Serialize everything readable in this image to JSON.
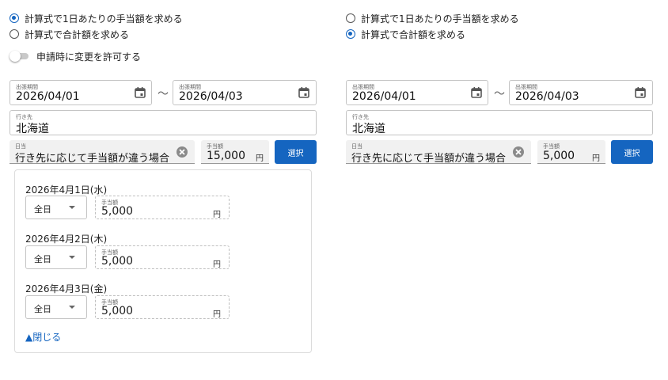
{
  "left": {
    "radio_daily": {
      "label": "計算式で1日あたりの手当額を求める",
      "checked": true
    },
    "radio_total": {
      "label": "計算式で合計額を求める",
      "checked": false
    },
    "toggle": {
      "label": "申請時に変更を許可する",
      "on": false
    },
    "period": {
      "label": "出張期間",
      "start": "2026/04/01",
      "tilde": "〜",
      "end": "2026/04/03"
    },
    "destination": {
      "label": "行き先",
      "value": "北海道"
    },
    "allowance_type": {
      "label": "日当",
      "value": "行き先に応じて手当額が違う場合"
    },
    "amount": {
      "label": "手当額",
      "value": "15,000",
      "unit": "円"
    },
    "select_button": "選択",
    "days": [
      {
        "date": "2026年4月1日(水)",
        "option": "全日",
        "amount_label": "手当額",
        "amount": "5,000",
        "unit": "円"
      },
      {
        "date": "2026年4月2日(木)",
        "option": "全日",
        "amount_label": "手当額",
        "amount": "5,000",
        "unit": "円"
      },
      {
        "date": "2026年4月3日(金)",
        "option": "全日",
        "amount_label": "手当額",
        "amount": "5,000",
        "unit": "円"
      }
    ],
    "close_link": "▲閉じる"
  },
  "right": {
    "radio_daily": {
      "label": "計算式で1日あたりの手当額を求める",
      "checked": false
    },
    "radio_total": {
      "label": "計算式で合計額を求める",
      "checked": true
    },
    "period": {
      "label": "出張期間",
      "start": "2026/04/01",
      "tilde": "〜",
      "end": "2026/04/03"
    },
    "destination": {
      "label": "行き先",
      "value": "北海道"
    },
    "allowance_type": {
      "label": "日当",
      "value": "行き先に応じて手当額が違う場合"
    },
    "amount": {
      "label": "手当額",
      "value": "5,000",
      "unit": "円"
    },
    "select_button": "選択"
  },
  "colors": {
    "accent": "#1565c0"
  }
}
